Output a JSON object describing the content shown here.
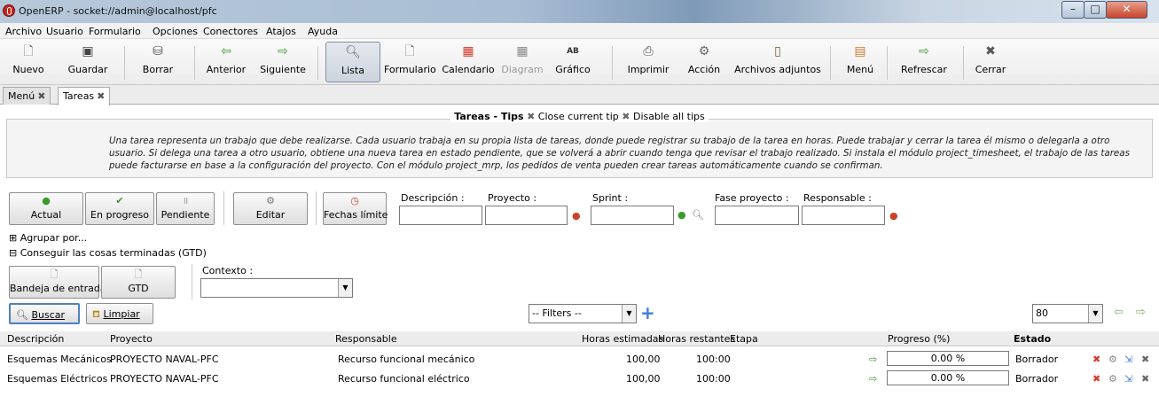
{
  "window": {
    "title": "OpenERP - socket://admin@localhost/pfc",
    "controls": [
      "–",
      "□",
      "✕"
    ]
  },
  "menubar": [
    "Archivo",
    "Usuario",
    "Formulario",
    "Opciones",
    "Conectores",
    "Atajos",
    "Ayuda"
  ],
  "toolbar": {
    "buttons": [
      {
        "label": "Nuevo",
        "icon": "new-document-icon"
      },
      {
        "label": "Guardar",
        "icon": "floppy-icon"
      },
      {
        "label": "Borrar",
        "icon": "trash-icon"
      },
      {
        "label": "Anterior",
        "icon": "arrow-left-icon"
      },
      {
        "label": "Siguiente",
        "icon": "arrow-right-icon"
      },
      {
        "label": "Lista",
        "icon": "magnifier-icon"
      },
      {
        "label": "Formulario",
        "icon": "form-icon"
      },
      {
        "label": "Calendario",
        "icon": "calendar-icon"
      },
      {
        "label": "Diagram",
        "icon": "diagram-icon"
      },
      {
        "label": "Gráfico",
        "icon": "graph-icon"
      },
      {
        "label": "Imprimir",
        "icon": "printer-icon"
      },
      {
        "label": "Acción",
        "icon": "gear-icon"
      },
      {
        "label": "Archivos adjuntos",
        "icon": "attachment-icon"
      },
      {
        "label": "Menú",
        "icon": "menu-icon"
      },
      {
        "label": "Refrescar",
        "icon": "refresh-icon"
      },
      {
        "label": "Cerrar",
        "icon": "close-icon"
      }
    ]
  },
  "tabs": [
    {
      "label": "Menú"
    },
    {
      "label": "Tareas"
    }
  ],
  "tips": {
    "title": "Tareas - Tips",
    "close_current": "Close current tip",
    "disable_all": "Disable all tips",
    "text": "Una tarea representa un trabajo que debe realizarse. Cada usuario trabaja en su propia lista de tareas, donde puede registrar su trabajo de la tarea en horas. Puede trabajar y cerrar la tarea él mismo o delegarla a otro usuario. Si delega una tarea a otro usuario, obtiene una nueva tarea en estado pendiente, que se volverá a abrir cuando tenga que revisar el trabajo realizado. Si instala el módulo project_timesheet, el trabajo de las tareas puede facturarse en base a la configuración del proyecto. Con el módulo project_mrp, los pedidos de venta pueden crear tareas automáticamente cuando se confirman."
  },
  "filters": {
    "state_buttons": [
      "Actual",
      "En progreso",
      "Pendiente"
    ],
    "edit_button": "Editar",
    "deadline_button": "Fechas límite",
    "fields": {
      "descripcion": "Descripción :",
      "proyecto": "Proyecto :",
      "sprint": "Sprint :",
      "fase": "Fase proyecto :",
      "responsable": "Responsable :"
    },
    "group_by": "Agrupar por...",
    "gtd_section": "Conseguir las cosas terminadas (GTD)",
    "gtd_buttons": [
      "Bandeja de entrada",
      "GTD"
    ],
    "contexto_label": "Contexto :",
    "search_button": "Buscar",
    "clear_button": "Limpiar",
    "filters_select": "-- Filters --",
    "limit": "80"
  },
  "table": {
    "headers": [
      "Descripción",
      "Proyecto",
      "Responsable",
      "Horas estimadas",
      "Horas restantes",
      "Etapa",
      "Progreso (%)",
      "Estado"
    ],
    "rows": [
      {
        "descripcion": "Esquemas Mecánicos",
        "proyecto": "PROYECTO NAVAL-PFC",
        "responsable": "Recurso funcional mecánico",
        "horas_estimadas": "100,00",
        "horas_restantes": "100:00",
        "progreso": "0.00 %",
        "estado": "Borrador"
      },
      {
        "descripcion": "Esquemas Eléctricos",
        "proyecto": "PROYECTO NAVAL-PFC",
        "responsable": "Recurso funcional eléctrico",
        "horas_estimadas": "100,00",
        "horas_restantes": "100:00",
        "progreso": "0.00 %",
        "estado": "Borrador"
      }
    ]
  },
  "colors": {
    "accent": "#4f7fc0",
    "green": "#3a9a2a",
    "red": "#c8432a"
  }
}
